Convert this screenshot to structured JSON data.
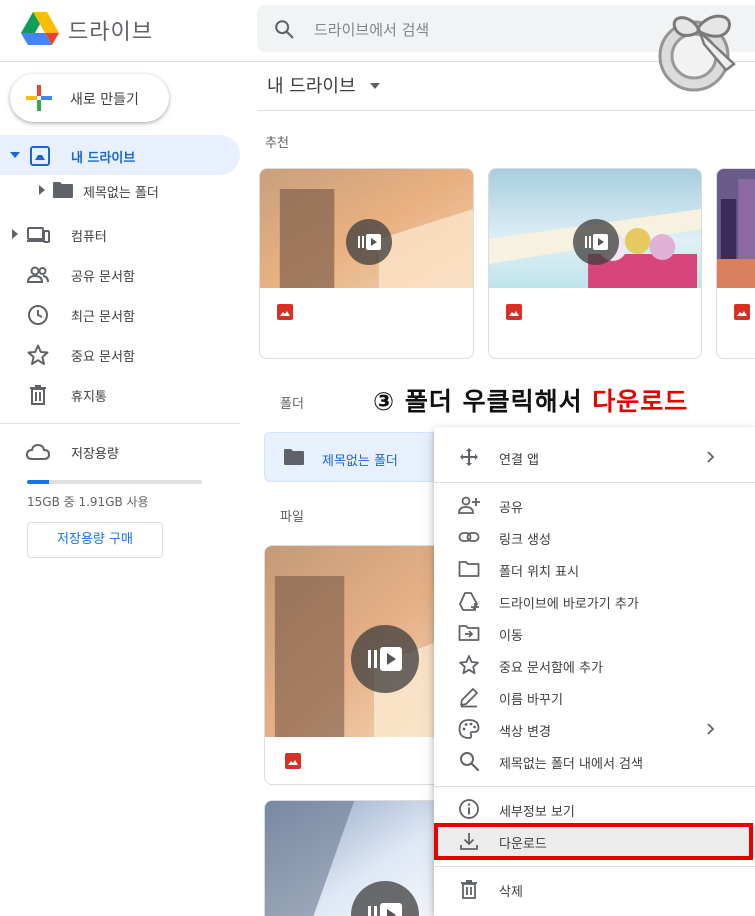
{
  "header": {
    "app_title": "드라이브",
    "search_placeholder": "드라이브에서 검색"
  },
  "sidebar": {
    "new_button_label": "새로 만들기",
    "items": [
      {
        "label": "내 드라이브",
        "icon": "my-drive-icon",
        "active": true
      },
      {
        "label": "제목없는 폴더",
        "icon": "folder-icon"
      },
      {
        "label": "컴퓨터",
        "icon": "computers-icon"
      },
      {
        "label": "공유 문서함",
        "icon": "shared-icon"
      },
      {
        "label": "최근 문서함",
        "icon": "clock-icon"
      },
      {
        "label": "중요 문서함",
        "icon": "star-icon"
      },
      {
        "label": "휴지통",
        "icon": "trash-icon"
      }
    ],
    "storage": {
      "label": "저장용량",
      "usage_text": "15GB 중 1.91GB 사용",
      "used_fraction": 0.127,
      "buy_label": "저장용량 구매"
    }
  },
  "main": {
    "breadcrumb": "내 드라이브",
    "suggested_label": "추천",
    "folders_label": "폴더",
    "files_label": "파일",
    "folder_name": "제목없는 폴더",
    "instruction_prefix": "③ 폴더 우클릭해서 ",
    "instruction_highlight": "다운로드"
  },
  "context_menu": {
    "items": [
      {
        "label": "연결 앱",
        "icon": "open-with-icon",
        "submenu": true
      },
      {
        "label": "공유",
        "icon": "share-person-icon"
      },
      {
        "label": "링크 생성",
        "icon": "link-icon"
      },
      {
        "label": "폴더 위치 표시",
        "icon": "folder-outline-icon"
      },
      {
        "label": "드라이브에 바로가기 추가",
        "icon": "add-shortcut-icon"
      },
      {
        "label": "이동",
        "icon": "move-icon"
      },
      {
        "label": "중요 문서함에 추가",
        "icon": "star-outline-icon"
      },
      {
        "label": "이름 바꾸기",
        "icon": "pencil-icon"
      },
      {
        "label": "색상 변경",
        "icon": "palette-icon",
        "submenu": true
      },
      {
        "label": "제목없는 폴더 내에서 검색",
        "icon": "search-icon"
      },
      {
        "label": "세부정보 보기",
        "icon": "info-icon"
      },
      {
        "label": "다운로드",
        "icon": "download-icon",
        "highlighted": true
      },
      {
        "label": "삭제",
        "icon": "trash-icon"
      }
    ]
  },
  "colors": {
    "accent": "#1a73e8",
    "active_bg": "#e8f0fe",
    "highlight_red": "#e60000",
    "image_icon_red": "#d93025"
  }
}
